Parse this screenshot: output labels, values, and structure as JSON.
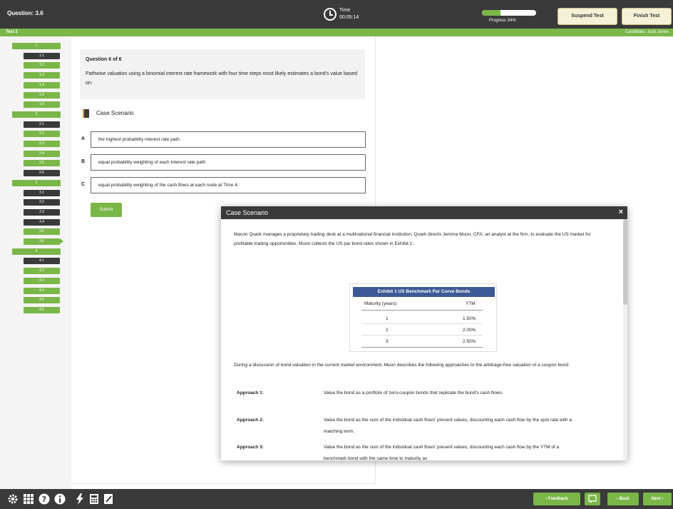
{
  "header": {
    "question_label": "Question: 3.6",
    "timer_label": "Time",
    "timer_value": "00:05:14",
    "progress_percent": 34,
    "progress_label": "Progress 34%",
    "suspend_label": "Suspend Test",
    "finish_label": "Finish Test"
  },
  "subheader": {
    "section": "Test 2",
    "candidate": "Candidate: Josh Jones"
  },
  "nav": {
    "groups": [
      "1",
      "2",
      "3",
      "4"
    ],
    "items": [
      {
        "label": "1.1",
        "status": "flagged"
      },
      {
        "label": "1.2",
        "status": "answered"
      },
      {
        "label": "1.3",
        "status": "answered"
      },
      {
        "label": "1.4",
        "status": "answered"
      },
      {
        "label": "1.5",
        "status": "answered"
      },
      {
        "label": "1.6",
        "status": "answered"
      },
      {
        "label": "2.1",
        "status": "flagged"
      },
      {
        "label": "2.2",
        "status": "answered"
      },
      {
        "label": "2.3",
        "status": "answered"
      },
      {
        "label": "2.4",
        "status": "answered"
      },
      {
        "label": "2.5",
        "status": "answered"
      },
      {
        "label": "2.6",
        "status": "flagged"
      },
      {
        "label": "3.1",
        "status": "flagged"
      },
      {
        "label": "3.2",
        "status": "flagged"
      },
      {
        "label": "3.3",
        "status": "flagged"
      },
      {
        "label": "3.4",
        "status": "flagged"
      },
      {
        "label": "3.5",
        "status": "answered"
      },
      {
        "label": "3.6",
        "status": "current"
      },
      {
        "label": "4.1",
        "status": "flagged"
      },
      {
        "label": "4.2",
        "status": "answered"
      },
      {
        "label": "4.3",
        "status": "answered"
      },
      {
        "label": "4.4",
        "status": "answered"
      },
      {
        "label": "4.5",
        "status": "answered"
      },
      {
        "label": "4.6",
        "status": "answered"
      }
    ]
  },
  "question": {
    "heading": "Question 6 of 6",
    "text": "Pathwise valuation using a binomial interest rate framework with four time steps most likely estimates a bond's value based on:",
    "case_link": "Case Scenario",
    "options": [
      {
        "letter": "A",
        "text": "the highest probability interest rate path."
      },
      {
        "letter": "B",
        "text": "equal probability weighting of each interest rate path."
      },
      {
        "letter": "C",
        "text": "equal probability weighting of the cash flows at each node at Time 4."
      }
    ],
    "submit_label": "Submit"
  },
  "modal": {
    "title": "Case Scenario",
    "close": "×",
    "intro": "Macon Quark manages a proprietary trading desk at a multinational financial institution. Quark directs Jemma Muon, CFA, an analyst at the firm, to evaluate the US market for profitable trading opportunities. Muon collects the US par bond rates shown in Exhibit 1:",
    "exhibit": {
      "title": "Exhibit 1 US Benchmark Par Curve Bonds",
      "col1": "Maturity (years)",
      "col2": "YTM",
      "rows": [
        {
          "maturity": "1",
          "ytm": "1.50%"
        },
        {
          "maturity": "2",
          "ytm": "2.00%"
        },
        {
          "maturity": "3",
          "ytm": "2.50%"
        }
      ]
    },
    "discussion": "During a discussion of bond valuation in the current market environment, Muon describes the following approaches to the arbitrage-free valuation of a coupon bond:",
    "approaches": [
      {
        "label": "Approach 1:",
        "text": "Value the bond as a portfolio of zero-coupon bonds that replicate the bond's cash flows."
      },
      {
        "label": "Approach 2:",
        "text": "Value the bond as the sum of the individual cash flows' present values, discounting each cash flow by the spot rate with a matching term."
      },
      {
        "label": "Approach 3:",
        "text": "Value the bond as the sum of the individual cash flows' present values, discounting each cash flow by the YTM of a benchmark bond with the same time to maturity as"
      }
    ]
  },
  "footer": {
    "icons": [
      "gear-icon",
      "grid-icon",
      "help-icon",
      "info-icon",
      "flash-icon",
      "calculator-icon",
      "notes-icon"
    ],
    "feedback_label": "Feedback",
    "back_label": "‹ Back",
    "next_label": "Next ›"
  },
  "colors": {
    "accent": "#7ab648",
    "dark": "#3a3a3a",
    "exhibit_header": "#3d5a96"
  }
}
